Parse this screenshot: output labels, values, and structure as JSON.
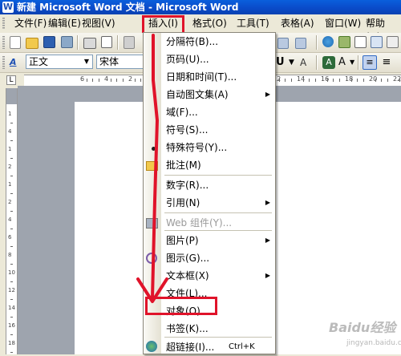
{
  "window": {
    "title": "新建 Microsoft Word 文档 - Microsoft Word",
    "app_icon": "word-app-icon"
  },
  "menubar": {
    "items": [
      {
        "label": "文件(F)",
        "name": "menu-file"
      },
      {
        "label": "编辑(E)",
        "name": "menu-edit"
      },
      {
        "label": "视图(V)",
        "name": "menu-view"
      },
      {
        "label": "插入(I)",
        "name": "menu-insert"
      },
      {
        "label": "格式(O)",
        "name": "menu-format"
      },
      {
        "label": "工具(T)",
        "name": "menu-tools"
      },
      {
        "label": "表格(A)",
        "name": "menu-table"
      },
      {
        "label": "窗口(W)",
        "name": "menu-window"
      },
      {
        "label": "帮助(H)",
        "name": "menu-help"
      }
    ]
  },
  "formatting": {
    "style_value": "正文",
    "font_value": "宋体",
    "style_icon": "styles-icon"
  },
  "insert_menu": {
    "items": [
      {
        "label": "分隔符(B)...",
        "enabled": true
      },
      {
        "label": "页码(U)...",
        "enabled": true
      },
      {
        "label": "日期和时间(T)...",
        "enabled": true
      },
      {
        "label": "自动图文集(A)",
        "enabled": true,
        "submenu": true
      },
      {
        "label": "域(F)...",
        "enabled": true
      },
      {
        "label": "符号(S)...",
        "enabled": true
      },
      {
        "label": "特殊符号(Y)...",
        "enabled": true
      },
      {
        "label": "批注(M)",
        "enabled": true
      },
      {
        "label": "数字(R)...",
        "enabled": true
      },
      {
        "label": "引用(N)",
        "enabled": true,
        "submenu": true
      },
      {
        "label": "Web 组件(Y)...",
        "enabled": false
      },
      {
        "label": "图片(P)",
        "enabled": true,
        "submenu": true
      },
      {
        "label": "图示(G)...",
        "enabled": true
      },
      {
        "label": "文本框(X)",
        "enabled": true,
        "submenu": true
      },
      {
        "label": "文件(L)...",
        "enabled": true
      },
      {
        "label": "对象(O)...",
        "enabled": true
      },
      {
        "label": "书签(K)...",
        "enabled": true
      },
      {
        "label": "超链接(I)...",
        "enabled": true,
        "shortcut": "Ctrl+K"
      }
    ],
    "submenu_arrow": "▶"
  },
  "ruler": {
    "h_numbers": [
      "6",
      "4",
      "2",
      "2",
      "4",
      "6",
      "8",
      "10",
      "12",
      "14",
      "16",
      "18",
      "20",
      "22"
    ],
    "v_numbers": [
      "1",
      "4",
      "1",
      "2",
      "1",
      "2",
      "4",
      "6",
      "8",
      "10",
      "12",
      "14",
      "16",
      "18"
    ],
    "tab_marker": "L"
  },
  "watermark": {
    "text": "Baidu经验",
    "sub": "jingyan.baidu.com"
  },
  "annotation": {
    "color": "#e0132a"
  },
  "colors": {
    "titlebar": "#0a4ac8",
    "menu_bg": "#ffffff",
    "chrome": "#ece9d8",
    "doc_bg": "#9ea4ae"
  }
}
